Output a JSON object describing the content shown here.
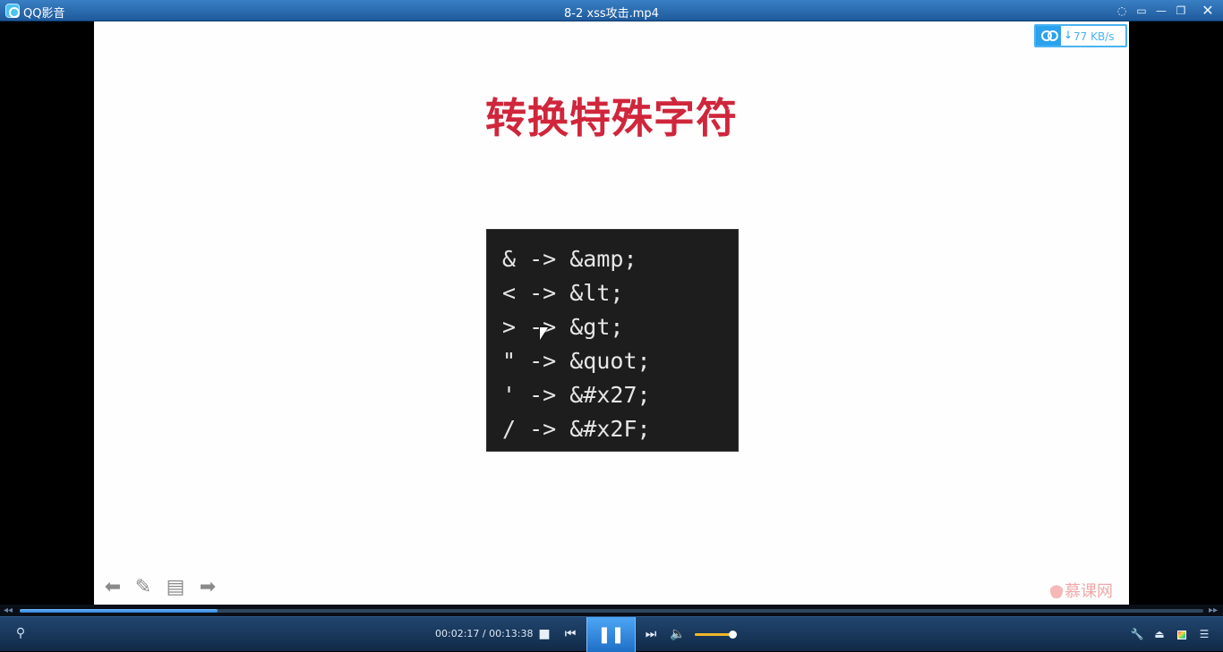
{
  "titlebar": {
    "app_name": "QQ影音",
    "window_title": "8-2 xss攻击.mp4",
    "chat_icon": "speech-bubble-icon",
    "mini_icon": "mini-mode-icon",
    "minimize_label": "—",
    "restore_label": "❐",
    "close_label": "✕"
  },
  "video": {
    "slide_title": "转换特殊字符",
    "code_lines": [
      "& -> &amp;",
      "< -> &lt;",
      "> -> &gt;",
      "\" -> &quot;",
      "' -> &#x27;",
      "/ -> &#x2F;"
    ],
    "net_speed": "77 KB/s",
    "net_arrow": "↓",
    "watermark": "慕课网",
    "tools": {
      "prev_glyph": "⬅",
      "pen_glyph": "✎",
      "notes_glyph": "▤",
      "next_glyph": "➡"
    }
  },
  "progress": {
    "fraction": 0.167,
    "back_glyph": "◂◂",
    "fwd_glyph": "▸▸"
  },
  "controls": {
    "current_time": "00:02:17",
    "separator": " / ",
    "total_time": "00:13:38",
    "stop_glyph": "■",
    "prev_glyph": "⏮",
    "pause_glyph": "❚❚",
    "next_glyph": "⏭",
    "volume_glyph": "🔈",
    "volume_level": 0.95,
    "footprint_glyph": "⚲",
    "tools_glyph": "🔧",
    "eject_glyph": "⏏",
    "playlist_glyph": "☰"
  },
  "colors": {
    "title_red": "#d0263b",
    "accent_blue": "#2aa2ee",
    "volume_yellow": "#f0b72a"
  }
}
